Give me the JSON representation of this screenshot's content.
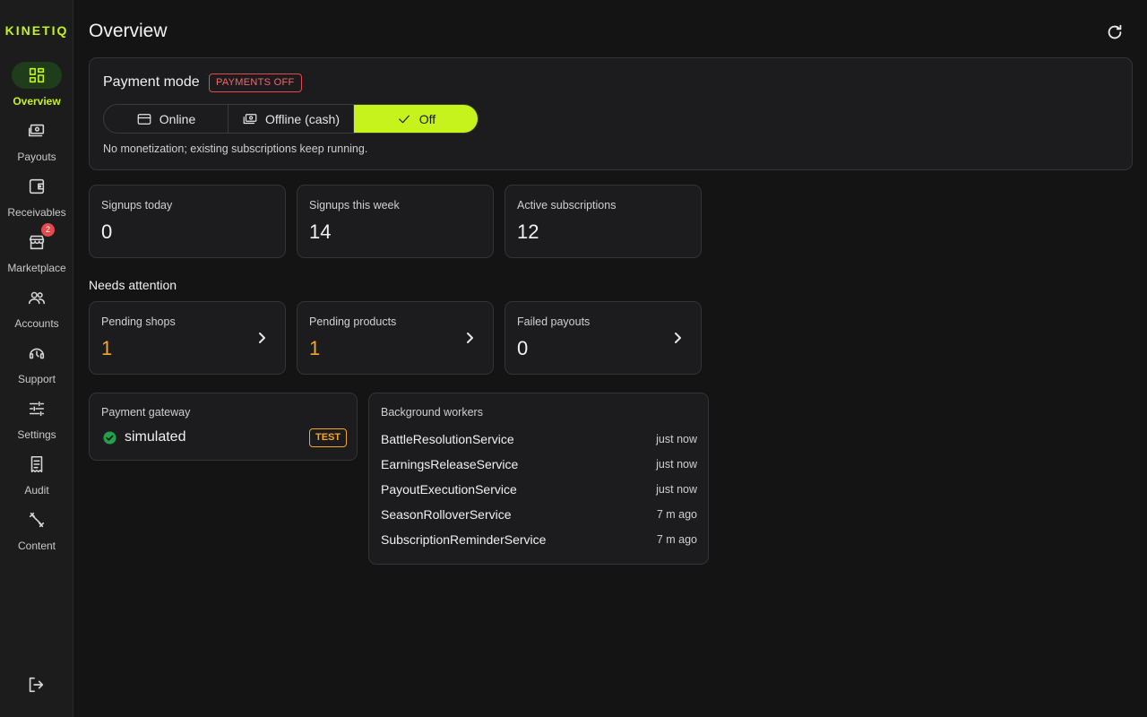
{
  "brand": "KINETIQ",
  "nav": [
    {
      "label": "Overview",
      "icon": "dashboard-icon",
      "active": true
    },
    {
      "label": "Payouts",
      "icon": "payouts-icon"
    },
    {
      "label": "Receivables",
      "icon": "wallet-icon"
    },
    {
      "label": "Marketplace",
      "icon": "store-icon",
      "badge": "2"
    },
    {
      "label": "Accounts",
      "icon": "people-icon"
    },
    {
      "label": "Support",
      "icon": "headset-icon"
    },
    {
      "label": "Settings",
      "icon": "sliders-icon"
    },
    {
      "label": "Audit",
      "icon": "receipt-icon"
    },
    {
      "label": "Content",
      "icon": "dumbbell-icon"
    }
  ],
  "header": {
    "title": "Overview"
  },
  "payment_mode": {
    "title": "Payment mode",
    "badge": "PAYMENTS OFF",
    "options": [
      {
        "label": "Online",
        "icon": "credit-card-icon"
      },
      {
        "label": "Offline (cash)",
        "icon": "cash-icon"
      },
      {
        "label": "Off",
        "icon": "check-icon",
        "selected": true
      }
    ],
    "description": "No monetization; existing subscriptions keep running."
  },
  "stats": [
    {
      "label": "Signups today",
      "value": "0"
    },
    {
      "label": "Signups this week",
      "value": "14"
    },
    {
      "label": "Active subscriptions",
      "value": "12"
    }
  ],
  "attention": {
    "title": "Needs attention",
    "items": [
      {
        "label": "Pending shops",
        "value": "1"
      },
      {
        "label": "Pending products",
        "value": "1"
      },
      {
        "label": "Failed payouts",
        "value": "0"
      }
    ]
  },
  "gateway": {
    "label": "Payment gateway",
    "name": "simulated",
    "badge": "TEST"
  },
  "workers": {
    "label": "Background workers",
    "items": [
      {
        "name": "BattleResolutionService",
        "time": "just now"
      },
      {
        "name": "EarningsReleaseService",
        "time": "just now"
      },
      {
        "name": "PayoutExecutionService",
        "time": "just now"
      },
      {
        "name": "SeasonRolloverService",
        "time": "7 m ago"
      },
      {
        "name": "SubscriptionReminderService",
        "time": "7 m ago"
      }
    ]
  },
  "colors": {
    "accent": "#c6f31b",
    "warning": "#f5a524",
    "danger": "#e5484d",
    "success": "#22a04b"
  }
}
